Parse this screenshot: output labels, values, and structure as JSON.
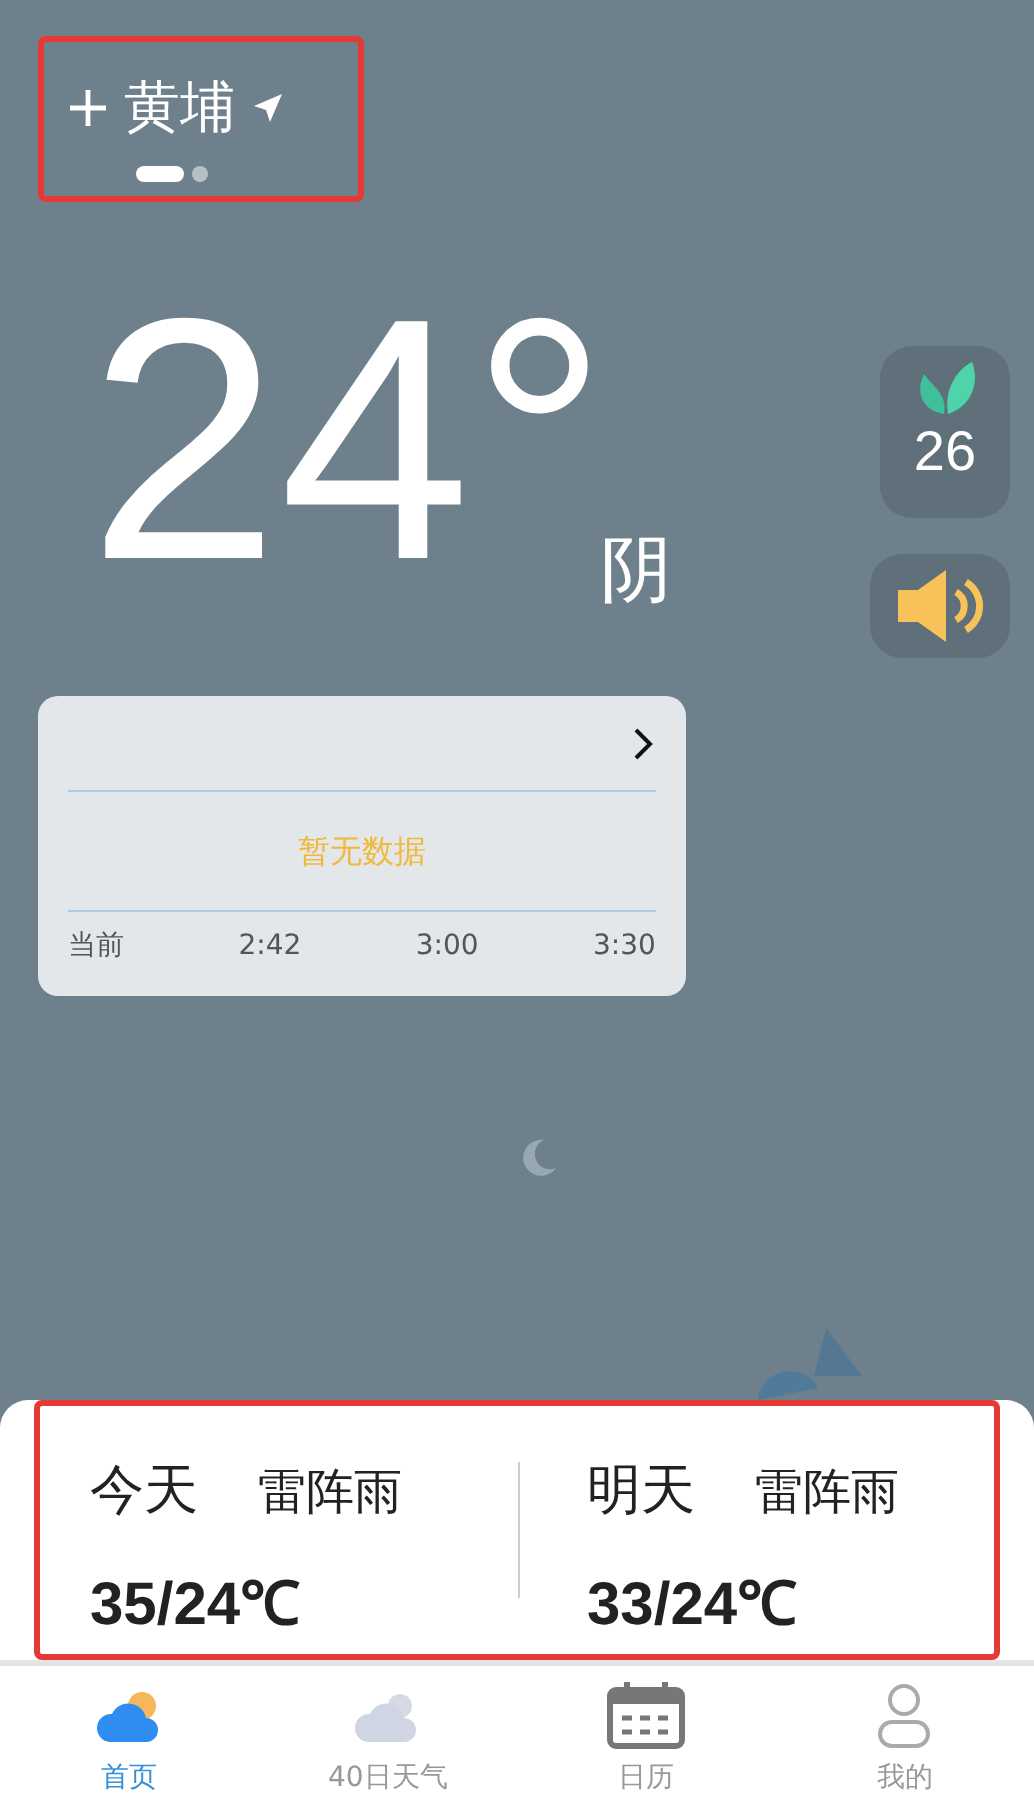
{
  "location": {
    "name": "黄埔"
  },
  "pages": [
    {
      "selected": true
    },
    {
      "selected": false
    }
  ],
  "current": {
    "temperature": "24°",
    "condition": "阴"
  },
  "air_quality": {
    "value": "26"
  },
  "precipitation_card": {
    "empty_text": "暂无数据",
    "times": [
      "当前",
      "2:42",
      "3:00",
      "3:30"
    ]
  },
  "forecast": [
    {
      "day": "今天",
      "condition": "雷阵雨",
      "temperature": "35/24℃"
    },
    {
      "day": "明天",
      "condition": "雷阵雨",
      "temperature": "33/24℃"
    }
  ],
  "tabs": [
    {
      "label": "首页",
      "selected": true
    },
    {
      "label": "40日天气",
      "selected": false
    },
    {
      "label": "日历",
      "selected": false
    },
    {
      "label": "我的",
      "selected": false
    }
  ]
}
